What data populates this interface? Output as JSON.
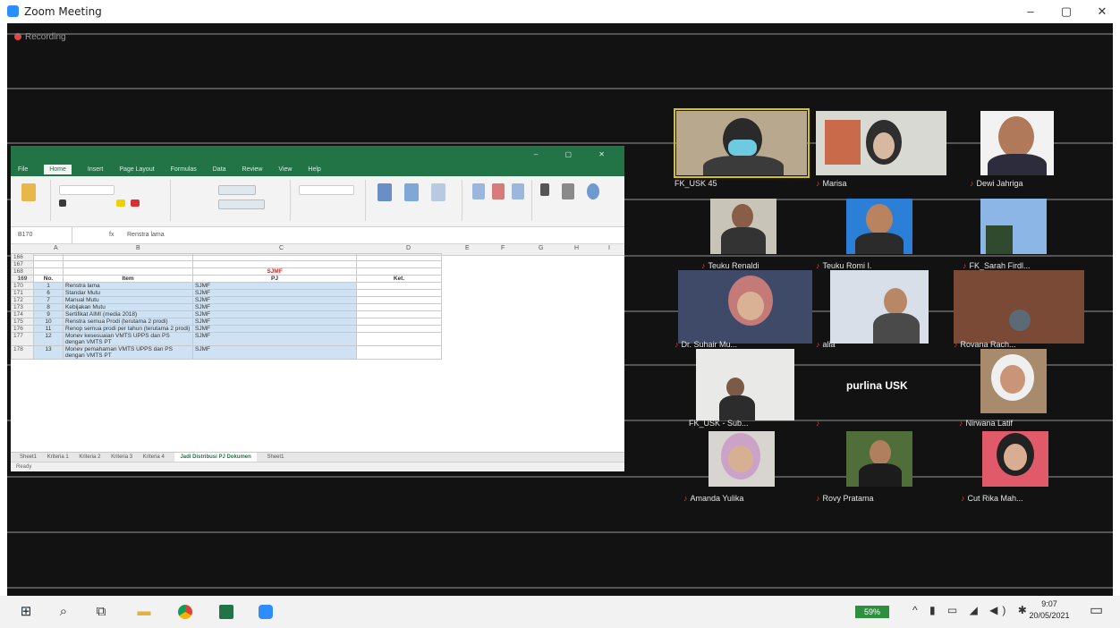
{
  "window": {
    "title": "Zoom Meeting",
    "minimize": "–",
    "maximize": "▢",
    "close": "✕"
  },
  "meeting": {
    "recording_label": "Recording"
  },
  "excel": {
    "ribbon_tabs": [
      "File",
      "Home",
      "Insert",
      "Page Layout",
      "Formulas",
      "Data",
      "Review",
      "View",
      "Help"
    ],
    "formula_bar": {
      "name_box": "B170",
      "fx": "fx",
      "value": "Renstra lama"
    },
    "column_headers": [
      "A",
      "B",
      "C",
      "D",
      "E",
      "F",
      "G",
      "H",
      "I"
    ],
    "title_cell": "SJMF",
    "header_row": {
      "row": "169",
      "no": "No.",
      "item": "Item",
      "pj": "PJ",
      "ket": "Ket."
    },
    "rows": [
      {
        "row": "170",
        "no": "1",
        "item": "Renstra lama",
        "pj": "SJMF"
      },
      {
        "row": "171",
        "no": "6",
        "item": "Standar Mutu",
        "pj": "SJMF"
      },
      {
        "row": "172",
        "no": "7",
        "item": "Manual Mutu",
        "pj": "SJMF"
      },
      {
        "row": "173",
        "no": "8",
        "item": "Kebijakan Mutu",
        "pj": "SJMF"
      },
      {
        "row": "174",
        "no": "9",
        "item": "Sertifikat AIMI (media 2018)",
        "pj": "SJMF"
      },
      {
        "row": "175",
        "no": "10",
        "item": "Renstra semua Prodi (terutama 2 prodi)",
        "pj": "SJMF"
      },
      {
        "row": "176",
        "no": "11",
        "item": "Renop semua prodi per tahun (terutama 2 prodi)",
        "pj": "SJMF"
      },
      {
        "row": "177",
        "no": "12",
        "item": "Monev kesesuaian VMTS UPPS dan PS dengan VMTS PT",
        "pj": "SJMF"
      },
      {
        "row": "178",
        "no": "13",
        "item": "Monev pemahaman VMTS UPPS dan PS dengan VMTS PT",
        "pj": "SJMF"
      }
    ],
    "blank_rows": [
      "166",
      "167",
      "168"
    ],
    "sheet_tabs": [
      "Sheet1",
      "Kriteria 1",
      "Kriteria 2",
      "Kriteria 3",
      "Kriteria 4",
      "Jadi Distribusi PJ Dokumen",
      "Sheet1"
    ],
    "status": "Ready"
  },
  "participants": [
    {
      "name": "FK_USK 45",
      "highlight": true
    },
    {
      "name": "Marisa"
    },
    {
      "name": "Dewi Jahriga"
    },
    {
      "name": "Teuku Renaldi"
    },
    {
      "name": "Teuku Romi I."
    },
    {
      "name": "FK_Sarah Firdl..."
    },
    {
      "name": "Dr. Suhair Mu..."
    },
    {
      "name": "alia"
    },
    {
      "name": "Rovana Rach..."
    },
    {
      "name": "FK_USK - Sub..."
    },
    {
      "name": "purlina USK"
    },
    {
      "name": "Nirwana Latif"
    },
    {
      "name": "Amanda Yulika"
    },
    {
      "name": "Rovy Pratama"
    },
    {
      "name": "Cut Rika Mah..."
    }
  ],
  "taskbar": {
    "battery": "59%",
    "time": "9:07",
    "date": "20/05/2021",
    "icons": [
      "windows-start-icon",
      "search-icon",
      "task-view-icon",
      "file-explorer-icon",
      "chrome-icon",
      "excel-icon",
      "zoom-icon"
    ]
  },
  "colors": {
    "excel_green": "#227447",
    "zoom_blue": "#2d8cff",
    "mic_muted": "#e0393e",
    "active_speaker": "#d8c400"
  }
}
